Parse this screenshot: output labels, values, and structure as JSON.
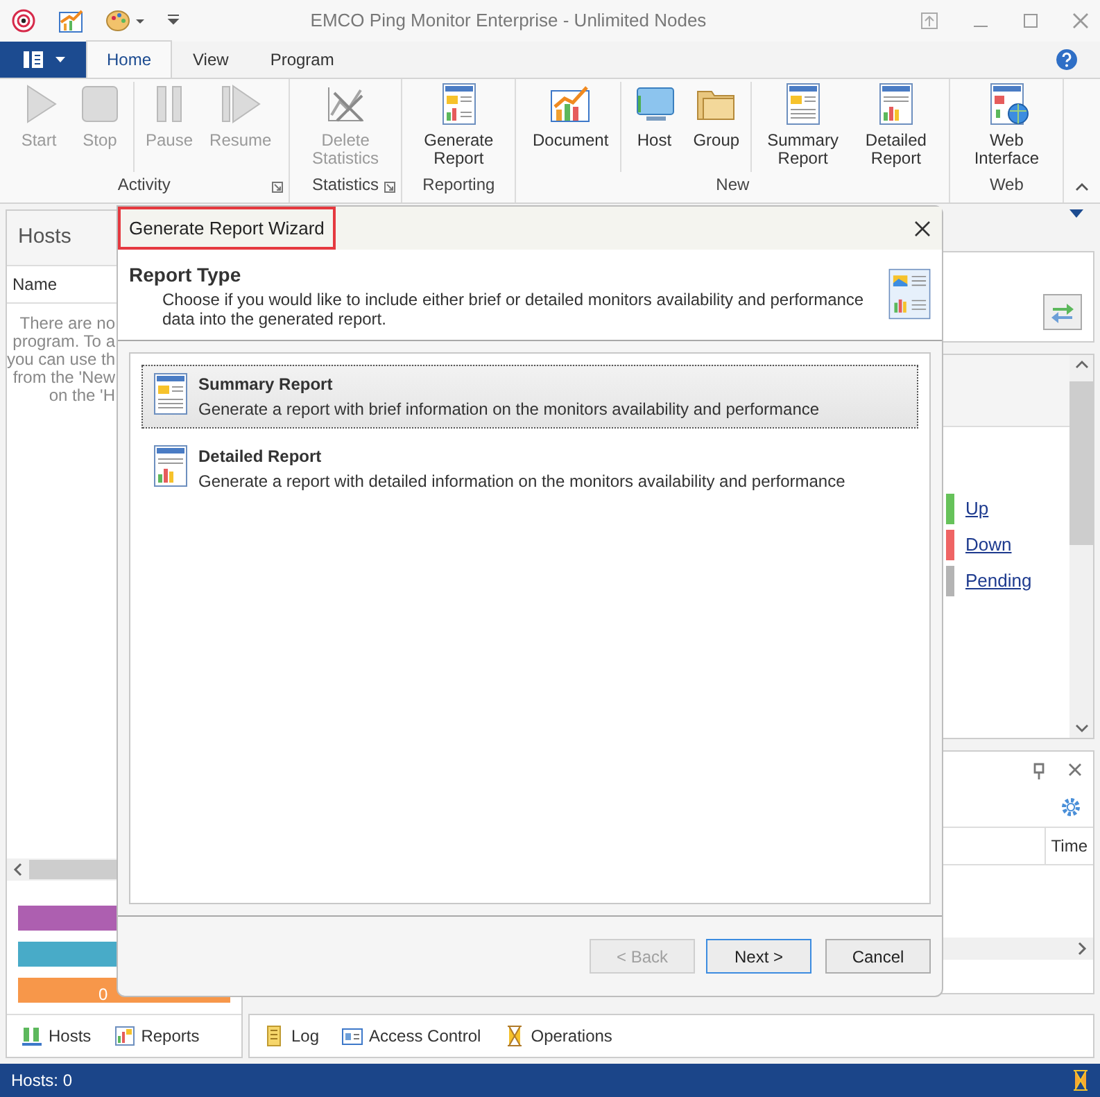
{
  "window": {
    "title": "EMCO Ping Monitor Enterprise - Unlimited Nodes"
  },
  "ribbon": {
    "tabs": [
      {
        "label": "Home",
        "selected": true
      },
      {
        "label": "View",
        "selected": false
      },
      {
        "label": "Program",
        "selected": false
      }
    ],
    "groups": [
      {
        "label": "Activity",
        "launcher": true,
        "clusters": [
          [
            {
              "label": "Start",
              "disabled": true
            },
            {
              "label": "Stop",
              "disabled": true
            }
          ],
          [
            {
              "label": "Pause",
              "disabled": true
            },
            {
              "label": "Resume",
              "disabled": true
            }
          ]
        ]
      },
      {
        "label": "Statistics",
        "launcher": true,
        "clusters": [
          [
            {
              "label": "Delete Statistics",
              "disabled": true
            }
          ]
        ]
      },
      {
        "label": "Reporting",
        "launcher": false,
        "clusters": [
          [
            {
              "label": "Generate Report",
              "disabled": false
            }
          ]
        ]
      },
      {
        "label": "New",
        "launcher": false,
        "clusters": [
          [
            {
              "label": "Document",
              "disabled": false
            }
          ],
          [
            {
              "label": "Host",
              "disabled": false
            },
            {
              "label": "Group",
              "disabled": false
            }
          ],
          [
            {
              "label": "Summary Report",
              "disabled": false
            },
            {
              "label": "Detailed Report",
              "disabled": false
            }
          ]
        ]
      },
      {
        "label": "Web",
        "launcher": false,
        "clusters": [
          [
            {
              "label": "Web Interface",
              "disabled": false
            }
          ]
        ]
      }
    ]
  },
  "hosts_pane": {
    "title": "Hosts",
    "column": "Name",
    "message_lines": [
      "There are no",
      "program. To a",
      "you can use th",
      "from the 'New",
      "on the 'H"
    ],
    "bars": [
      {
        "color": "#ad5fb0"
      },
      {
        "color": "#48abc8"
      },
      {
        "color": "#f7974a",
        "text": "0"
      }
    ],
    "tabs": [
      "Hosts",
      "Reports"
    ]
  },
  "legend": [
    {
      "label": "Up",
      "color": "#66c25a"
    },
    {
      "label": "Down",
      "color": "#ef6464"
    },
    {
      "label": "Pending",
      "color": "#b4b4b4"
    }
  ],
  "log_pane": {
    "column": "Time"
  },
  "bottom_tabs": [
    "Log",
    "Access Control",
    "Operations"
  ],
  "status_bar": {
    "text": "Hosts: 0"
  },
  "dialog": {
    "title": "Generate Report Wizard",
    "heading": "Report Type",
    "description": "Choose if you would like to include either brief or detailed monitors availability and performance data into the generated report.",
    "options": [
      {
        "title": "Summary Report",
        "description": "Generate a report with brief information on the monitors availability and performance",
        "selected": true
      },
      {
        "title": "Detailed Report",
        "description": "Generate a report with detailed information on the monitors availability and performance",
        "selected": false
      }
    ],
    "buttons": [
      {
        "label": "< Back",
        "disabled": true,
        "default": false
      },
      {
        "label": "Next >",
        "disabled": false,
        "default": true
      },
      {
        "label": "Cancel",
        "disabled": false,
        "default": false
      }
    ]
  }
}
